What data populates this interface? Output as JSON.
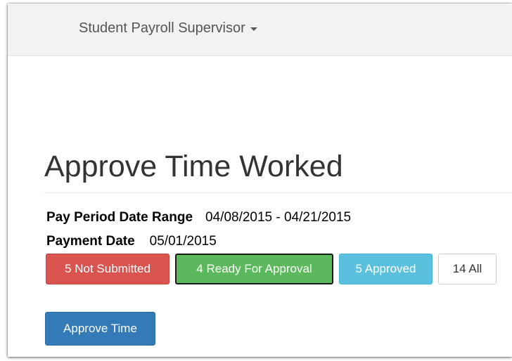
{
  "nav": {
    "menu_label": "Student Payroll Supervisor",
    "menu_icon": "caret-down-icon"
  },
  "page": {
    "title": "Approve Time Worked"
  },
  "pay_period": {
    "range_label": "Pay Period Date Range",
    "range_value": "04/08/2015 - 04/21/2015",
    "payment_label": "Payment Date",
    "payment_value": "05/01/2015"
  },
  "filters": [
    {
      "label": "5 Not Submitted",
      "color": "#d9534f"
    },
    {
      "label": "4 Ready For Approval",
      "color": "#5cb85c",
      "selected": true
    },
    {
      "label": "5 Approved",
      "color": "#5bc0de"
    },
    {
      "label": "14 All",
      "color": "#ffffff"
    }
  ],
  "actions": {
    "approve_label": "Approve Time",
    "approve_color": "#337ab7"
  }
}
